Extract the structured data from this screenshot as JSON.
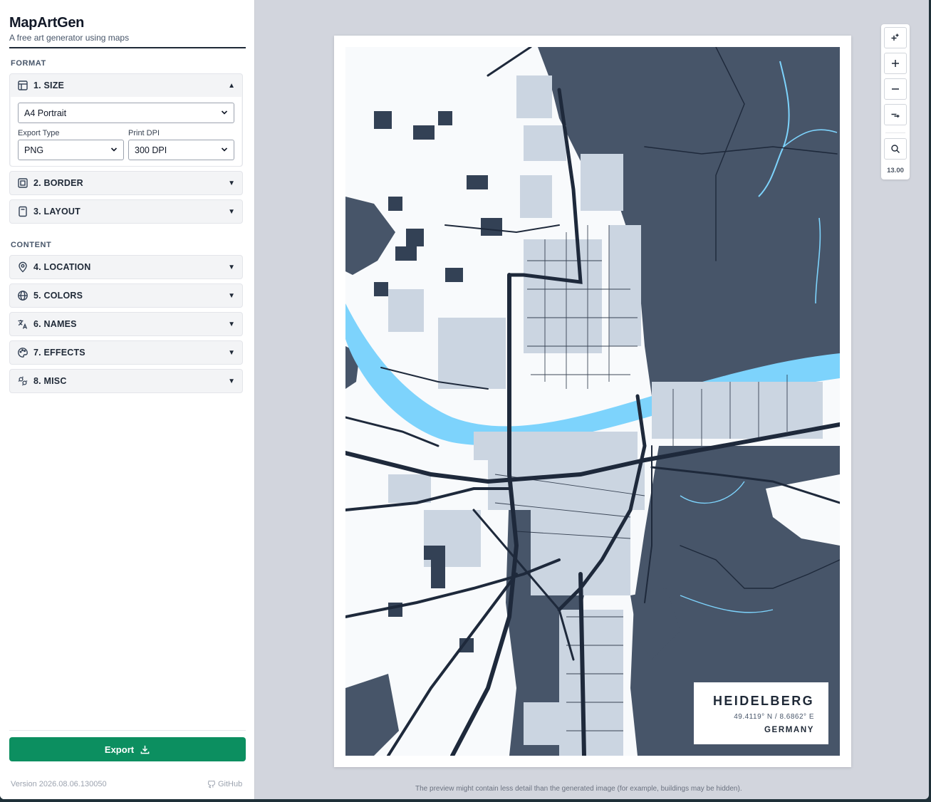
{
  "app": {
    "title": "MapArtGen",
    "subtitle": "A free art generator using maps"
  },
  "sections": {
    "format": "FORMAT",
    "content": "CONTENT"
  },
  "size_panel": {
    "title": "1. SIZE",
    "paper": "A4 Portrait",
    "export_type_label": "Export Type",
    "export_type": "PNG",
    "dpi_label": "Print DPI",
    "dpi": "300 DPI"
  },
  "panels": {
    "border": "2. BORDER",
    "layout": "3. LAYOUT",
    "location": "4. LOCATION",
    "colors": "5. COLORS",
    "names": "6. NAMES",
    "effects": "7. EFFECTS",
    "misc": "8. MISC"
  },
  "export": {
    "label": "Export"
  },
  "footer": {
    "version": "Version 2026.08.06.130050",
    "github": "GitHub"
  },
  "poster": {
    "city": "HEIDELBERG",
    "coords": "49.4119° N / 8.6862° E",
    "country": "GERMANY"
  },
  "zoom": {
    "level": "13.00"
  },
  "notice": "The preview might contain less detail than the generated image (for example, buildings may be hidden).",
  "colors": {
    "accent": "#0c8f60",
    "land": "#475569",
    "water": "#7dd3fc",
    "roads": "#1e293b",
    "background": "#f8fafc",
    "buildings": "#cbd5e1"
  },
  "icons": [
    "layout-icon",
    "border-icon",
    "page-icon",
    "pin-icon",
    "globe-icon",
    "translate-icon",
    "palette-icon",
    "misc-icon",
    "download-icon",
    "github-icon",
    "zoom-fit-icon",
    "zoom-in-icon",
    "zoom-out-icon",
    "zoom-reset-icon",
    "search-icon"
  ]
}
